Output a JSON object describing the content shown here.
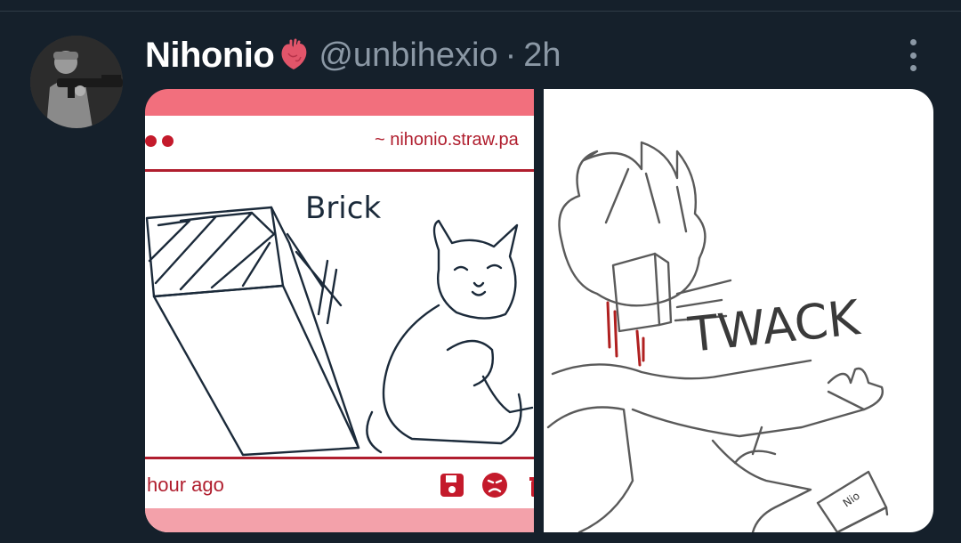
{
  "tweet": {
    "display_name": "Nihonio",
    "handle": "@unbihexio",
    "separator": "·",
    "timestamp": "2h",
    "name_emoji": "anatomical-heart-emoji"
  },
  "media": {
    "left_image": {
      "url_text": "~ nihonio.straw.pa",
      "drawing_text": "Brick",
      "age_text": "hour ago",
      "icons": [
        "save-icon",
        "angry-face-icon",
        "trash-icon"
      ],
      "accent_color": "#b01e2e"
    },
    "right_image": {
      "drawing_text": "TWACK",
      "book_label": "Nio"
    }
  },
  "colors": {
    "background": "#15202b",
    "name": "#ffffff",
    "secondary": "#8b98a5"
  }
}
